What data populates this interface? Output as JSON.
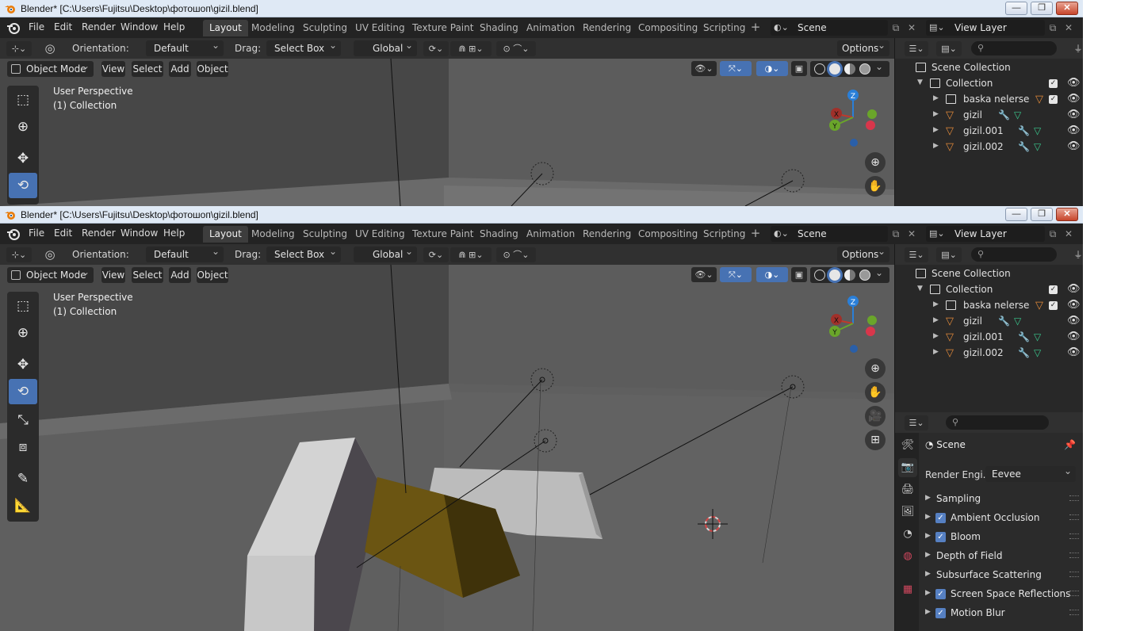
{
  "window": {
    "title": "Blender* [C:\\Users\\Fujitsu\\Desktop\\фотошоп\\gizil.blend]",
    "controls": [
      "—",
      "❐",
      "✕"
    ]
  },
  "menu": [
    "File",
    "Edit",
    "Render",
    "Window",
    "Help"
  ],
  "workspace_tabs": [
    "Layout",
    "Modeling",
    "Sculpting",
    "UV Editing",
    "Texture Paint",
    "Shading",
    "Animation",
    "Rendering",
    "Compositing",
    "Scripting"
  ],
  "active_workspace": "Layout",
  "scene_name": "Scene",
  "view_layer": "View Layer",
  "tool_header": {
    "orientation_label": "Orientation:",
    "orientation_value": "Default",
    "drag_label": "Drag:",
    "drag_value": "Select Box",
    "transform_space": "Global",
    "options_label": "Options"
  },
  "viewport": {
    "mode": "Object Mode",
    "menus": [
      "View",
      "Select",
      "Add",
      "Object"
    ],
    "perspective": "User Perspective",
    "collection": "(1) Collection",
    "axes": {
      "x": "X",
      "y": "Y",
      "z": "Z"
    }
  },
  "outliner": {
    "root": "Scene Collection",
    "collection": "Collection",
    "items": [
      {
        "name": "baska nelerse"
      },
      {
        "name": "gizil"
      },
      {
        "name": "gizil.001"
      },
      {
        "name": "gizil.002"
      }
    ]
  },
  "properties": {
    "title": "Scene",
    "render_engine_label": "Render Engi...",
    "render_engine": "Eevee",
    "panels": [
      {
        "label": "Sampling",
        "checked": false
      },
      {
        "label": "Ambient Occlusion",
        "checked": true
      },
      {
        "label": "Bloom",
        "checked": true
      },
      {
        "label": "Depth of Field",
        "checked": false
      },
      {
        "label": "Subsurface Scattering",
        "checked": false
      },
      {
        "label": "Screen Space Reflections",
        "checked": true
      },
      {
        "label": "Motion Blur",
        "checked": true
      }
    ]
  },
  "colors": {
    "accent": "#4772b3",
    "object_orange": "#e38a3a",
    "viewport_bg": "#5a5a5a"
  }
}
